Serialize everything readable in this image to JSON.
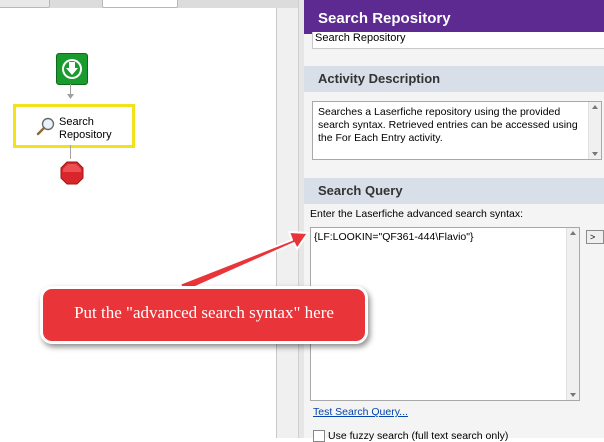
{
  "workflow": {
    "activity_label": "Search Repository",
    "activity_icon": "magnifier-icon",
    "start_icon": "start-arrow-icon",
    "stop_icon": "stop-octagon-icon"
  },
  "properties": {
    "title": "Search Repository",
    "name_value": "Search Repository",
    "description_header": "Activity Description",
    "description_text": "Searches a Laserfiche repository using the provided search syntax.  Retrieved entries can be accessed using the For Each Entry activity.",
    "query_header": "Search Query",
    "query_instruction": "Enter the Laserfiche advanced search syntax:",
    "query_value": "{LF:LOOKIN=\"QF361-444\\Flavio\"}",
    "expand_button_label": ">",
    "test_link": "Test Search Query...",
    "fuzzy_label": "Use fuzzy search (full text search only)"
  },
  "callout": {
    "text": "Put the \"advanced search syntax\" here"
  },
  "colors": {
    "header_purple": "#5c2a91",
    "section_header": "#d8dfe9",
    "highlight_yellow": "#f2e21c",
    "callout_red": "#e9353a",
    "start_green": "#1a9b2e",
    "stop_red": "#d9262c",
    "link_blue": "#0645ad"
  }
}
